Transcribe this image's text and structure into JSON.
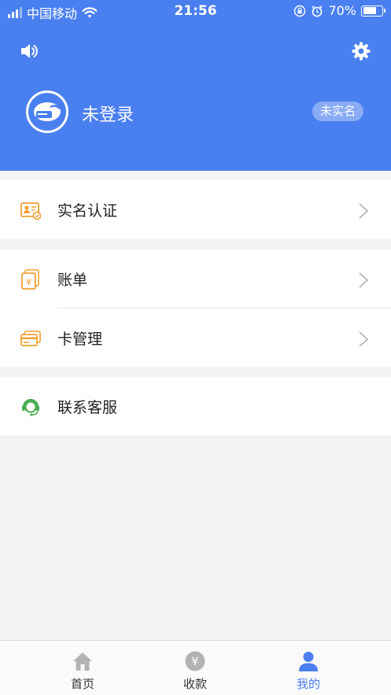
{
  "status_bar": {
    "carrier": "中国移动",
    "time": "21:56",
    "battery": "70%",
    "battery_level": 0.7
  },
  "header": {
    "speaker_icon": "speaker-icon",
    "settings_icon": "gear-icon",
    "username": "未登录",
    "realname_badge": "未实名"
  },
  "menu": {
    "realname": {
      "label": "实名认证",
      "icon": "id-card-icon"
    },
    "bill": {
      "label": "账单",
      "icon": "yuan-bill-icon"
    },
    "card": {
      "label": "卡管理",
      "icon": "bank-card-icon"
    },
    "service": {
      "label": "联系客服",
      "icon": "headset-icon"
    }
  },
  "tabbar": {
    "items": [
      {
        "label": "首页",
        "icon": "home-icon"
      },
      {
        "label": "收款",
        "icon": "yuan-circle-icon"
      },
      {
        "label": "我的",
        "icon": "user-icon"
      }
    ],
    "active": 2
  },
  "colors": {
    "primary": "#4a7ff0",
    "orange": "#f0a030",
    "green": "#4cae54",
    "page_bg": "#f4f4f4"
  }
}
